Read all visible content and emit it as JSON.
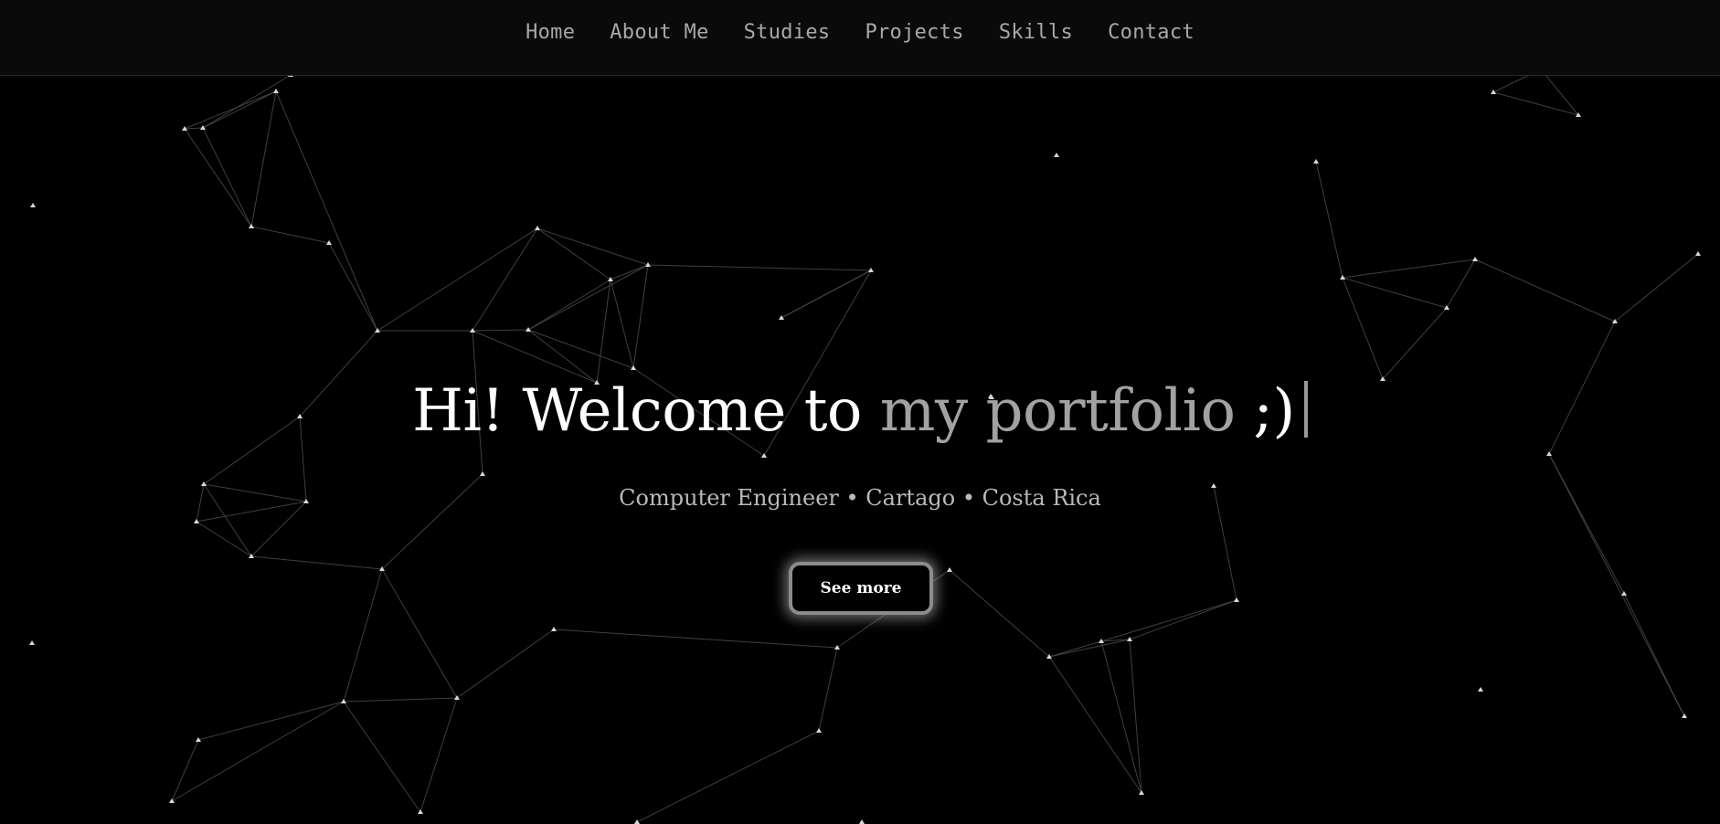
{
  "nav": {
    "items": [
      {
        "label": "Home"
      },
      {
        "label": "About Me"
      },
      {
        "label": "Studies"
      },
      {
        "label": "Projects"
      },
      {
        "label": "Skills"
      },
      {
        "label": "Contact"
      }
    ]
  },
  "hero": {
    "title_main": "Hi! Welcome to ",
    "title_accent": "my portfolio",
    "title_end": " ;)",
    "subtitle": "Computer Engineer • Cartago • Costa Rica",
    "button_label": "See more"
  },
  "colors": {
    "background": "#000000",
    "nav_text": "#a8a8a8",
    "accent_text": "#a2a2a2",
    "network_line": "#4a4a4a",
    "network_node": "#d8d8d8"
  }
}
